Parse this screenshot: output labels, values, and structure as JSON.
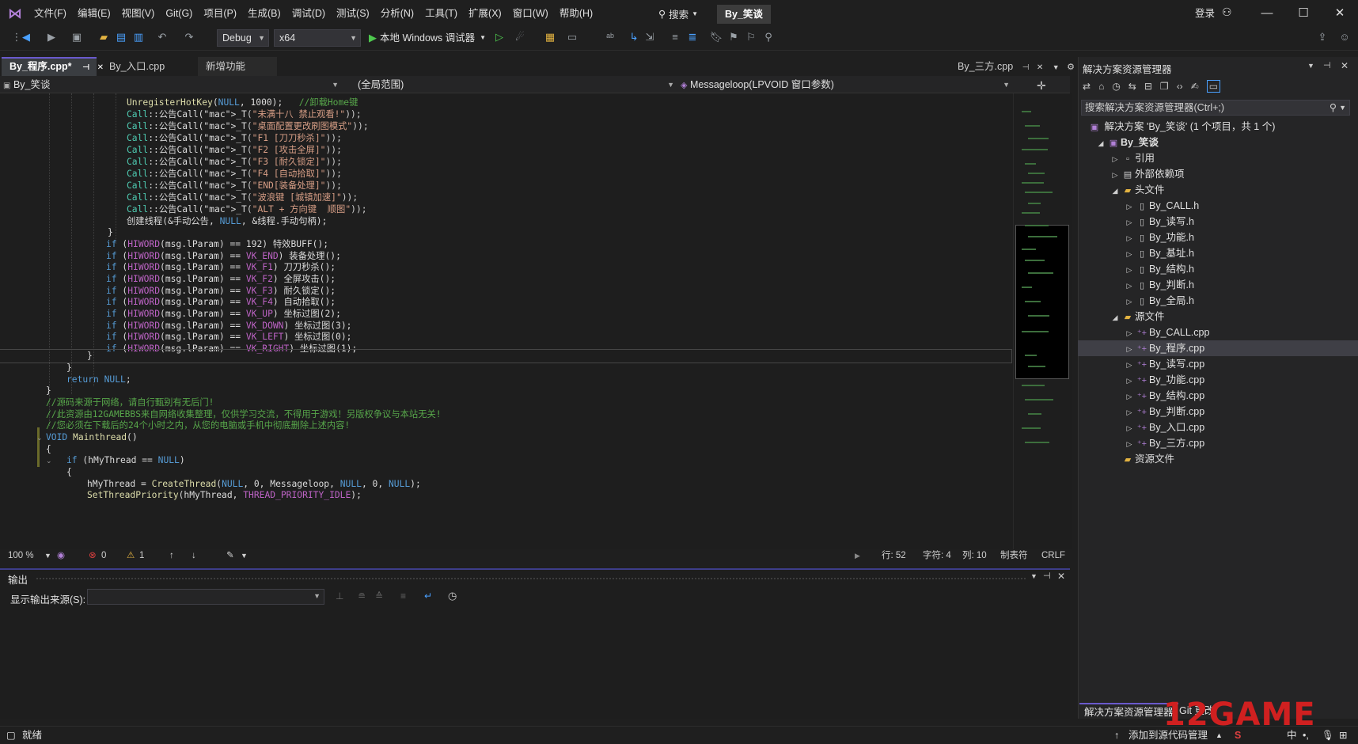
{
  "menu": [
    "文件(F)",
    "编辑(E)",
    "视图(V)",
    "Git(G)",
    "项目(P)",
    "生成(B)",
    "调试(D)",
    "测试(S)",
    "分析(N)",
    "工具(T)",
    "扩展(X)",
    "窗口(W)",
    "帮助(H)"
  ],
  "search_label": "搜索",
  "project_badge": "By_笑谈",
  "login": "登录",
  "toolbar": {
    "config": "Debug",
    "platform": "x64",
    "run_label": "本地 Windows 调试器"
  },
  "tabs": {
    "left": [
      {
        "label": "By_程序.cpp*",
        "active": true
      },
      {
        "label": "By_入口.cpp",
        "active": false
      },
      {
        "label": "新增功能",
        "active": false
      }
    ],
    "right": "By_三方.cpp"
  },
  "nav": {
    "project": "By_笑谈",
    "scope": "(全局范围)",
    "function": "Messageloop(LPVOID 窗口参数)"
  },
  "code_lines": [
    "UnregisterHotKey(NULL, 1000);   //卸载Home键",
    "Call::公告Call(_T(\"未满十八 禁止观看!\"));",
    "Call::公告Call(_T(\"桌面配置更改刷图模式\"));",
    "Call::公告Call(_T(\"F1 [刀刀秒杀]\"));",
    "Call::公告Call(_T(\"F2 [攻击全屏]\"));",
    "Call::公告Call(_T(\"F3 [耐久锁定]\"));",
    "Call::公告Call(_T(\"F4 [自动拾取]\"));",
    "Call::公告Call(_T(\"END[装备处理]\"));",
    "Call::公告Call(_T(\"波浪键 [城镇加速]\"));",
    "Call::公告Call(_T(\"ALT + 方向键  顺图\"));",
    "创建线程(&手动公告, NULL, &线程.手动句柄);",
    "}",
    "if (HIWORD(msg.lParam) == 192) 特效BUFF();",
    "if (HIWORD(msg.lParam) == VK_END) 装备处理();",
    "if (HIWORD(msg.lParam) == VK_F1) 刀刀秒杀();",
    "if (HIWORD(msg.lParam) == VK_F2) 全屏攻击();",
    "if (HIWORD(msg.lParam) == VK_F3) 耐久锁定();",
    "if (HIWORD(msg.lParam) == VK_F4) 自动拾取();",
    "if (HIWORD(msg.lParam) == VK_UP) 坐标过图(2);",
    "if (HIWORD(msg.lParam) == VK_DOWN) 坐标过图(3);",
    "if (HIWORD(msg.lParam) == VK_LEFT) 坐标过图(0);",
    "if (HIWORD(msg.lParam) == VK_RIGHT) 坐标过图(1);",
    "}",
    "}",
    "return NULL;",
    "}",
    "//源码来源于网络，请自行甄别有无后门!",
    "//此资源由12GAMEBBS来自网络收集整理，仅供学习交流，不得用于游戏！另版权争议与本站无关!",
    "//您必须在下载后的24个小时之内，从您的电脑或手机中彻底删除上述内容!",
    "VOID Mainthread()",
    "{",
    "if (hMyThread == NULL)",
    "{",
    "hMyThread = CreateThread(NULL, 0, Messageloop, NULL, 0, NULL);",
    "SetThreadPriority(hMyThread, THREAD_PRIORITY_IDLE);"
  ],
  "editor_status": {
    "zoom": "100 %",
    "errors": "0",
    "warnings": "1",
    "line": "行: 52",
    "char": "字符: 4",
    "col": "列: 10",
    "tabs": "制表符",
    "eol": "CRLF"
  },
  "output": {
    "title": "输出",
    "source_label": "显示输出来源(S):"
  },
  "solution": {
    "title": "解决方案资源管理器",
    "search": "搜索解决方案资源管理器(Ctrl+;)",
    "root": "解决方案 'By_笑谈' (1 个项目，共 1 个)",
    "tree": [
      {
        "label": "By_笑谈",
        "level": 1,
        "arrow": "▲",
        "icon": "project"
      },
      {
        "label": "引用",
        "level": 2,
        "arrow": "▷",
        "icon": "ref"
      },
      {
        "label": "外部依赖项",
        "level": 2,
        "arrow": "▷",
        "icon": "ext"
      },
      {
        "label": "头文件",
        "level": 2,
        "arrow": "▲",
        "icon": "folder"
      },
      {
        "label": "By_CALL.h",
        "level": 3,
        "arrow": "▷",
        "icon": "h"
      },
      {
        "label": "By_读写.h",
        "level": 3,
        "arrow": "▷",
        "icon": "h"
      },
      {
        "label": "By_功能.h",
        "level": 3,
        "arrow": "▷",
        "icon": "h"
      },
      {
        "label": "By_基址.h",
        "level": 3,
        "arrow": "▷",
        "icon": "h"
      },
      {
        "label": "By_结构.h",
        "level": 3,
        "arrow": "▷",
        "icon": "h"
      },
      {
        "label": "By_判断.h",
        "level": 3,
        "arrow": "▷",
        "icon": "h"
      },
      {
        "label": "By_全局.h",
        "level": 3,
        "arrow": "▷",
        "icon": "h"
      },
      {
        "label": "源文件",
        "level": 2,
        "arrow": "▲",
        "icon": "folder"
      },
      {
        "label": "By_CALL.cpp",
        "level": 3,
        "arrow": "▷",
        "icon": "cpp"
      },
      {
        "label": "By_程序.cpp",
        "level": 3,
        "arrow": "▷",
        "icon": "cpp",
        "selected": true
      },
      {
        "label": "By_读写.cpp",
        "level": 3,
        "arrow": "▷",
        "icon": "cpp"
      },
      {
        "label": "By_功能.cpp",
        "level": 3,
        "arrow": "▷",
        "icon": "cpp"
      },
      {
        "label": "By_结构.cpp",
        "level": 3,
        "arrow": "▷",
        "icon": "cpp"
      },
      {
        "label": "By_判断.cpp",
        "level": 3,
        "arrow": "▷",
        "icon": "cpp"
      },
      {
        "label": "By_入口.cpp",
        "level": 3,
        "arrow": "▷",
        "icon": "cpp"
      },
      {
        "label": "By_三方.cpp",
        "level": 3,
        "arrow": "▷",
        "icon": "cpp"
      },
      {
        "label": "资源文件",
        "level": 2,
        "arrow": "",
        "icon": "folder"
      }
    ],
    "bottom_tabs": [
      "解决方案资源管理器",
      "Git 更改"
    ]
  },
  "statusbar": {
    "ready": "就绪",
    "source_control": "添加到源代码管理",
    "ime": "中"
  },
  "watermark": "12GAME",
  "colors": {
    "accent": "#6a5acd",
    "keyword": "#569cd6",
    "comment": "#57a64a",
    "string": "#d69d85",
    "class": "#4ec9b0"
  }
}
